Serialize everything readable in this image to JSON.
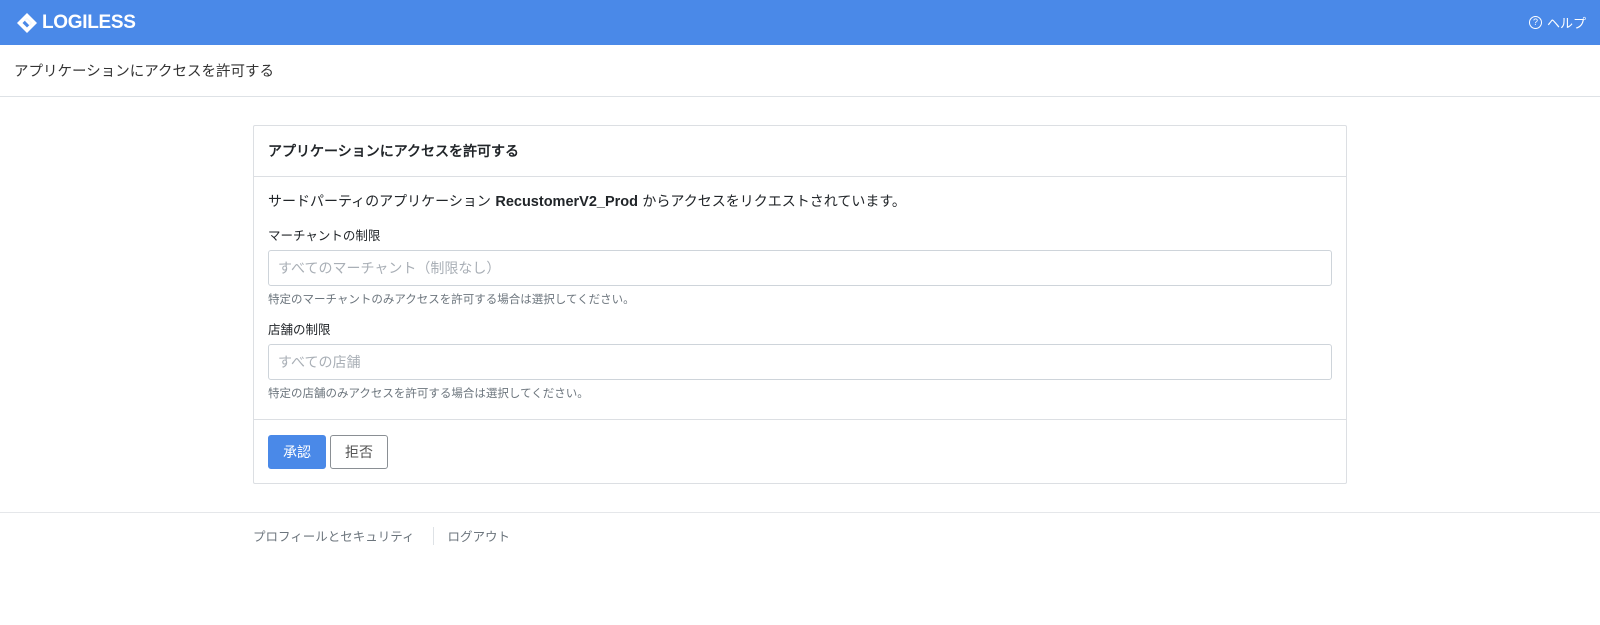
{
  "topbar": {
    "brand": "LOGILESS",
    "logo_icon": "diamond-logo-icon",
    "help_label": "ヘルプ",
    "help_icon_glyph": "?",
    "bg_color": "#4a89e8"
  },
  "page_header": {
    "title": "アプリケーションにアクセスを許可する"
  },
  "card": {
    "title": "アプリケーションにアクセスを許可する",
    "intro_prefix": "サードパーティのアプリケーション ",
    "app_name": "RecustomerV2_Prod",
    "intro_suffix": " からアクセスをリクエストされています。",
    "merchant": {
      "label": "マーチャントの制限",
      "placeholder": "すべてのマーチャント（制限なし）",
      "help": "特定のマーチャントのみアクセスを許可する場合は選択してください。"
    },
    "store": {
      "label": "店舗の制限",
      "placeholder": "すべての店舗",
      "help": "特定の店舗のみアクセスを許可する場合は選択してください。"
    },
    "approve_label": "承認",
    "reject_label": "拒否"
  },
  "footer": {
    "profile_link": "プロフィールとセキュリティ",
    "logout_link": "ログアウト"
  }
}
